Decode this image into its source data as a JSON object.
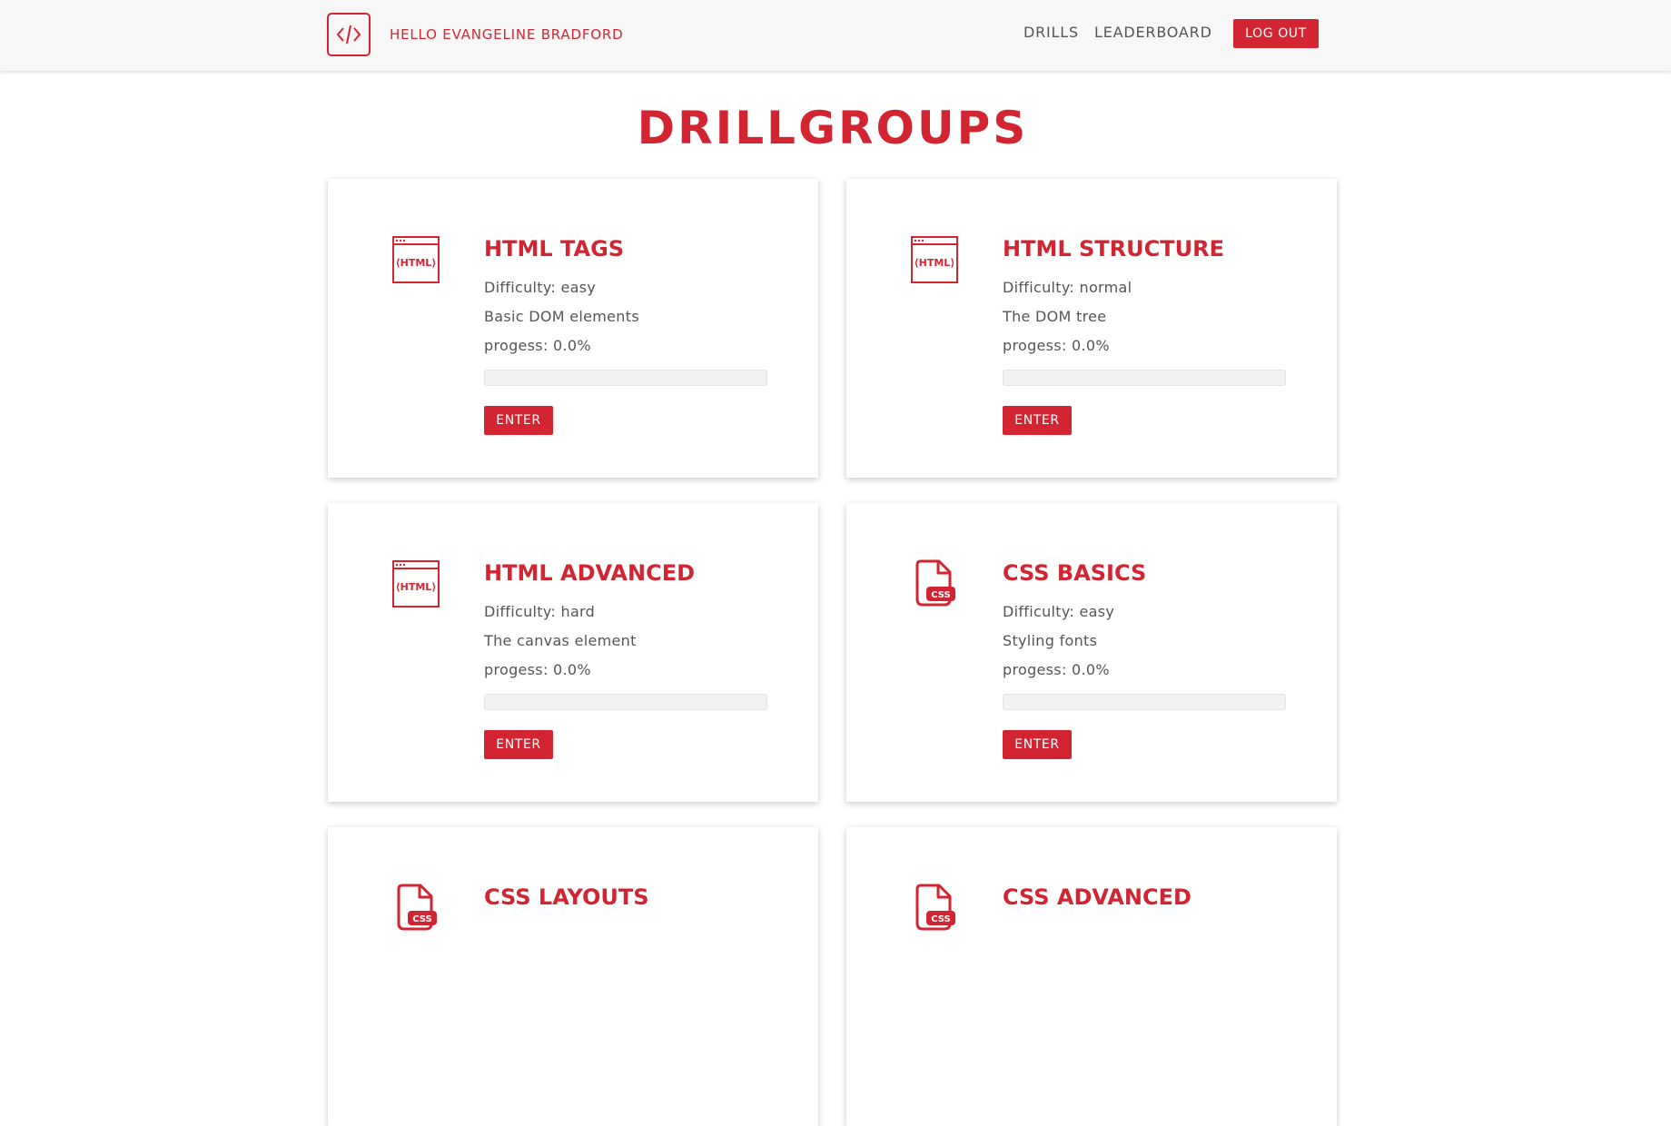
{
  "navbar": {
    "greeting": "HELLO EVANGELINE BRADFORD",
    "links": [
      "DRILLS",
      "LEADERBOARD"
    ],
    "logout_label": "LOG OUT",
    "logo_icon": "code-brackets-icon"
  },
  "accent_color": "#d22531",
  "page_title": "DRILLGROUPS",
  "cards": [
    {
      "title": "HTML TAGS",
      "difficulty": "Difficulty: easy",
      "description": "Basic DOM elements",
      "progress_text": "progess: 0.0%",
      "progress": 0.0,
      "enter_label": "ENTER",
      "icon": "html-window-icon"
    },
    {
      "title": "HTML STRUCTURE",
      "difficulty": "Difficulty: normal",
      "description": "The DOM tree",
      "progress_text": "progess: 0.0%",
      "progress": 0.0,
      "enter_label": "ENTER",
      "icon": "html-window-icon"
    },
    {
      "title": "HTML ADVANCED",
      "difficulty": "Difficulty: hard",
      "description": "The canvas element",
      "progress_text": "progess: 0.0%",
      "progress": 0.0,
      "enter_label": "ENTER",
      "icon": "html-window-icon"
    },
    {
      "title": "CSS BASICS",
      "difficulty": "Difficulty: easy",
      "description": "Styling fonts",
      "progress_text": "progess: 0.0%",
      "progress": 0.0,
      "enter_label": "ENTER",
      "icon": "css-file-icon"
    },
    {
      "title": "CSS LAYOUTS",
      "icon": "css-file-icon"
    },
    {
      "title": "CSS ADVANCED",
      "icon": "css-file-icon"
    }
  ]
}
